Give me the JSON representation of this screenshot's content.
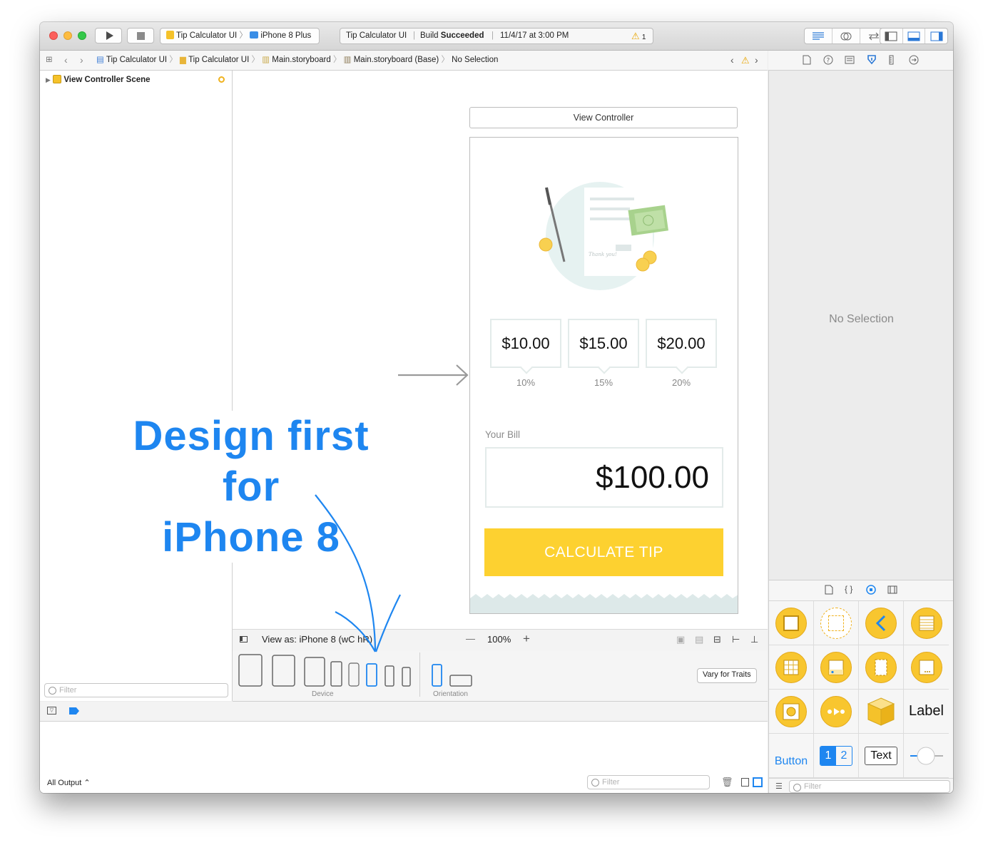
{
  "toolbar": {
    "scheme_target": "Tip Calculator UI",
    "scheme_device": "iPhone 8 Plus",
    "activity_project": "Tip Calculator UI",
    "activity_status_prefix": "Build",
    "activity_status": "Succeeded",
    "activity_time": "11/4/17 at 3:00 PM",
    "warning_count": "1"
  },
  "jumpbar": {
    "crumbs": [
      "Tip Calculator UI",
      "Tip Calculator UI",
      "Main.storyboard",
      "Main.storyboard (Base)",
      "No Selection"
    ]
  },
  "navigator": {
    "scene": "View Controller Scene",
    "filter_placeholder": "Filter"
  },
  "scene": {
    "title": "View Controller",
    "tips": [
      {
        "amount": "$10.00",
        "percent": "10%"
      },
      {
        "amount": "$15.00",
        "percent": "15%"
      },
      {
        "amount": "$20.00",
        "percent": "20%"
      }
    ],
    "bill_label": "Your Bill",
    "bill_value": "$100.00",
    "button": "CALCULATE TIP",
    "note_text": "Thank you!"
  },
  "annotation": {
    "line1": "Design first for",
    "line2": "iPhone 8"
  },
  "canvas_bar": {
    "view_as": "View as: iPhone 8 (wC hR)",
    "zoom": "100%",
    "zoom_out": "—",
    "zoom_in": "+"
  },
  "device_bar": {
    "device_label": "Device",
    "orientation_label": "Orientation",
    "vary_button": "Vary for Traits"
  },
  "inspector": {
    "empty": "No Selection"
  },
  "library": {
    "label_item": "Label",
    "button_item": "Button",
    "seg_1": "1",
    "seg_2": "2",
    "text_item": "Text",
    "filter_placeholder": "Filter"
  },
  "debug": {
    "output_select": "All Output ⌃",
    "filter_placeholder": "Filter"
  },
  "colors": {
    "accent": "#1e86f0",
    "button_yellow": "#fdd130",
    "library_yellow": "#f8c62f",
    "mint": "#e6f2f1"
  }
}
